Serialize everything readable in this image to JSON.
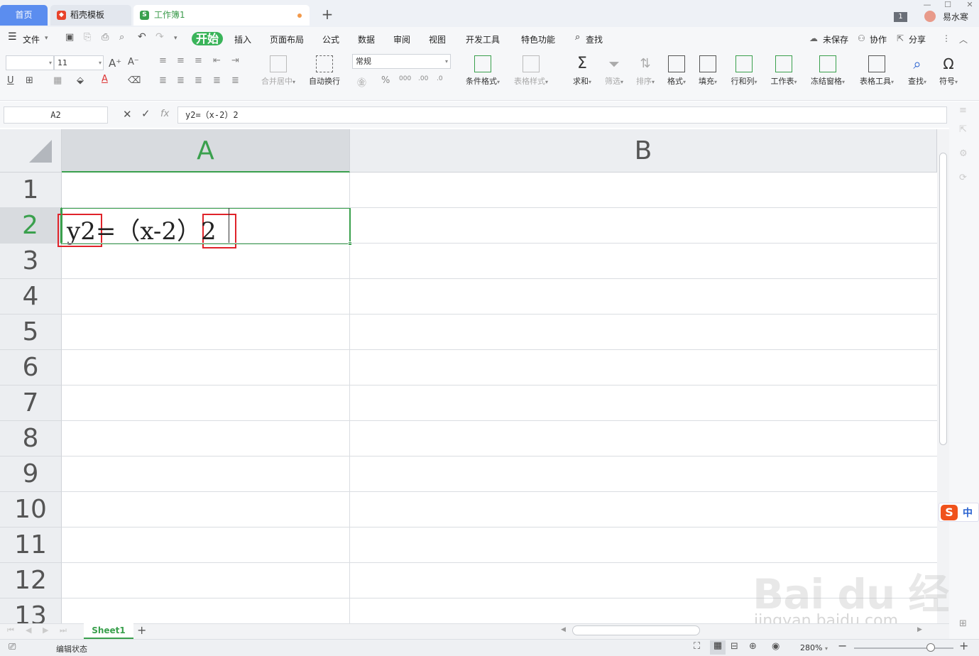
{
  "tabs": [
    {
      "label": "首页"
    },
    {
      "label": "稻壳模板"
    },
    {
      "label": "工作簿1"
    }
  ],
  "titlebar": {
    "window_count": "1",
    "username": "易水寒",
    "minimize": "—",
    "maximize": "☐",
    "close": "✕"
  },
  "menu": {
    "file": "文件",
    "items": [
      "开始",
      "插入",
      "页面布局",
      "公式",
      "数据",
      "审阅",
      "视图",
      "开发工具",
      "特色功能"
    ],
    "search": "查找",
    "unsaved": "未保存",
    "collab": "协作",
    "share": "分享"
  },
  "ribbon": {
    "font_size": "11",
    "merge_center": "合并居中",
    "wrap_text": "自动换行",
    "number_format": "常规",
    "cond_format": "条件格式",
    "table_style": "表格样式",
    "sum": "求和",
    "filter": "筛选",
    "sort": "排序",
    "format": "格式",
    "fill": "填充",
    "row_col": "行和列",
    "worksheet": "工作表",
    "freeze": "冻结窗格",
    "table_tools": "表格工具",
    "find": "查找",
    "symbol": "符号",
    "percent": "%",
    "thousands": "000"
  },
  "formula_bar": {
    "name_box": "A2",
    "fx": "fx",
    "formula": "y2=（x-2）2"
  },
  "grid": {
    "columns": [
      "A",
      "B"
    ],
    "rows": [
      "1",
      "2",
      "3",
      "4",
      "5",
      "6",
      "7",
      "8",
      "9",
      "10",
      "11",
      "12",
      "13"
    ],
    "active_cell_text": "y2=（x-2）2"
  },
  "sheets": {
    "active": "Sheet1",
    "add": "+"
  },
  "status": {
    "mode": "编辑状态",
    "zoom": "280%"
  },
  "ime": {
    "logo": "S",
    "lang": "中"
  },
  "watermark": {
    "line1": "Bai du 经验",
    "line2": "jingyan.baidu.com"
  }
}
